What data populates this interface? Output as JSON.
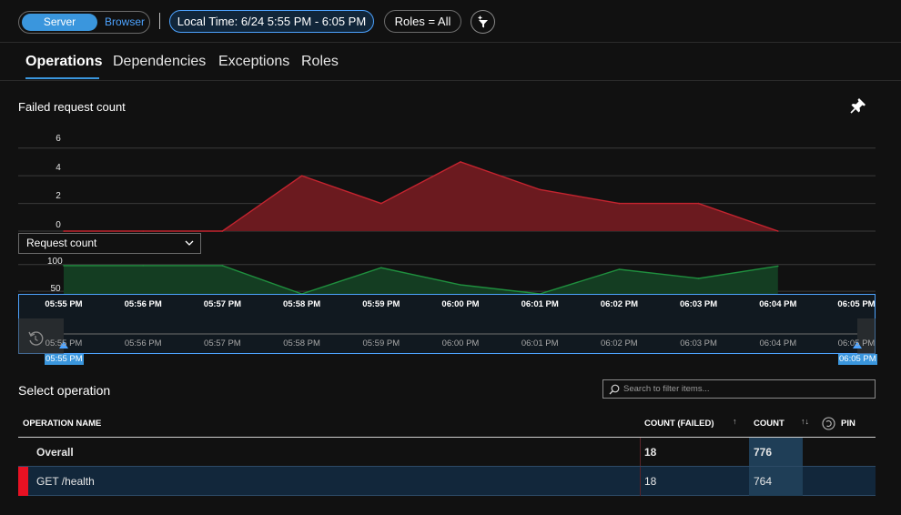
{
  "toolbar": {
    "mode_active": "Server",
    "mode_inactive": "Browser",
    "time_filter": "Local Time: 6/24 5:55 PM - 6:05 PM",
    "roles_filter": "Roles = All",
    "add_filter_icon": "filter-add-icon"
  },
  "tabs": [
    {
      "label": "Operations",
      "active": true
    },
    {
      "label": "Dependencies",
      "active": false
    },
    {
      "label": "Exceptions",
      "active": false
    },
    {
      "label": "Roles",
      "active": false
    }
  ],
  "chart": {
    "title": "Failed request count",
    "pin_icon": "pin-icon",
    "metric_selector": "Request count"
  },
  "chart_data": [
    {
      "type": "area",
      "title": "Failed request count",
      "x": [
        "05:55 PM",
        "05:56 PM",
        "05:57 PM",
        "05:58 PM",
        "05:59 PM",
        "06:00 PM",
        "06:01 PM",
        "06:02 PM",
        "06:03 PM",
        "06:04 PM"
      ],
      "y_ticks": [
        "0",
        "2",
        "4",
        "6"
      ],
      "ylim": [
        0,
        7
      ],
      "series": [
        {
          "values": [
            0,
            0,
            0,
            4,
            2,
            5,
            3,
            2,
            2,
            0
          ],
          "color": "#6b1a1f",
          "line_color": "#c4242f"
        }
      ],
      "grid": true
    },
    {
      "type": "area",
      "title": "Request count",
      "x": [
        "05:55 PM",
        "05:56 PM",
        "05:57 PM",
        "05:58 PM",
        "05:59 PM",
        "06:00 PM",
        "06:01 PM",
        "06:02 PM",
        "06:03 PM",
        "06:04 PM"
      ],
      "y_ticks": [
        "50",
        "100"
      ],
      "ylim": [
        45,
        120
      ],
      "series": [
        {
          "values": [
            98,
            98,
            98,
            45,
            94,
            62,
            45,
            91,
            74,
            97
          ],
          "color": "#143d22",
          "line_color": "#1f8f3e"
        }
      ],
      "grid": true
    }
  ],
  "timeline": {
    "labels": [
      "05:55 PM",
      "05:56 PM",
      "05:57 PM",
      "05:58 PM",
      "05:59 PM",
      "06:00 PM",
      "06:01 PM",
      "06:02 PM",
      "06:03 PM",
      "06:04 PM",
      "06:05 PM"
    ],
    "brush_start": "05:55 PM",
    "brush_end": "06:05 PM",
    "reset_icon": "reset-zoom-icon"
  },
  "operations": {
    "title": "Select operation",
    "search_placeholder": "Search to filter items...",
    "columns": {
      "name": "OPERATION NAME",
      "count_failed": "COUNT (FAILED)",
      "count": "COUNT",
      "pin": "PIN"
    },
    "rows": [
      {
        "name": "Overall",
        "count_failed": "18",
        "count": "776"
      },
      {
        "name": "GET /health",
        "count_failed": "18",
        "count": "764"
      }
    ]
  }
}
